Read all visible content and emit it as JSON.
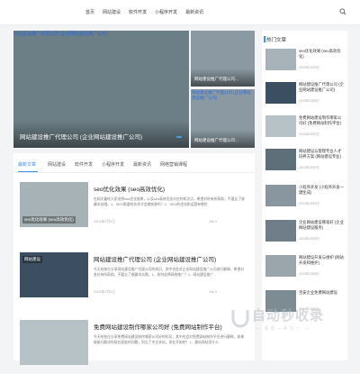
{
  "nav": {
    "items": [
      "首页",
      "网站建设",
      "软件开发",
      "小程序开发",
      "最新资讯"
    ]
  },
  "hero": {
    "image_alt": "网站建设推广代理公司 (企业网站建设推广公司)",
    "caption": "网站建设推广代理公司 (企业网站建设推广公司)"
  },
  "side_cards": [
    {
      "image_alt": "",
      "caption": "网站建设推广代理公司..."
    },
    {
      "image_alt": "网站建设推广代理公司 (企业网站建设推广公司)",
      "caption": "网站建设推广代理公司..."
    }
  ],
  "tabs": [
    "最新文章",
    "网站建设",
    "软件开发",
    "小程序开发",
    "最新资讯",
    "网络营销课程"
  ],
  "articles": [
    {
      "title": "seo优化效果 (seo高效优化)",
      "thumb_label": "seo优化效果 (seo高效优化)",
      "excerpt": "在网文童给大家说到seo优化效果，以及seo高效优化对应的知识点，希望对你有所帮助，不要忘了收藏本站哦。1、SEO需要的技术才会做效果吗？2、SEO的优化和运营有哪些",
      "date": "2024年2月9日",
      "meta": "19k  0"
    },
    {
      "title": "网站建设推广代理公司 (企业网站建设推广公司)",
      "thumb_label": "网站建设",
      "excerpt": "今天给各位分享网站建设推广代理公司的知识，其中也会对企业网站建设推广公司进行解释，希望对各位有所帮助，不要忘了收藏本站哦。1、如何选择网络推广？2、网站建设推广...",
      "date": "2024年2月9日",
      "meta": "19k  0"
    },
    {
      "title": "免费网站建设制作哪家公司好 (免费网站制作平台)",
      "thumb_label": "",
      "excerpt": "今天给各位分享免费网站建设制作哪家公司好的知识，其中也会对免费网站制作平台进行解释，如果能碰巧解决你现在面临的问题，别忘了关注本站，现在开始吧！1、建站网站用什么",
      "date": "",
      "meta": ""
    }
  ],
  "sidebar": {
    "title": "热门文章",
    "items": [
      {
        "text": "seo优化效果 (seo高效优化)",
        "date": "2024年2月9日"
      },
      {
        "text": "网站建设推广代理公司 (企业网站建设推广公司)",
        "date": "2024年2月9日"
      },
      {
        "text": "免费网站建设制作哪家公司好 (免费网站制作平台)",
        "date": "2024年2月9日"
      },
      {
        "text": "网站建设与管理专业人才培养方案 (网站建设专业)",
        "date": "2024年2月9日"
      },
      {
        "text": "小程序开发 (小程序开发一键生成)",
        "date": "2024年2月9日"
      },
      {
        "text": "企业网站建设哪家好 (企业网站建设服务)",
        "date": "2024年2月9日"
      },
      {
        "text": "网站建设开发与维护 (网站开发和维护)",
        "date": "2024年2月9日"
      },
      {
        "text": "宝安企业免费网站建设",
        "date": "2024年2月9日"
      }
    ]
  },
  "watermark": {
    "text": "自动秒收录",
    "sub": "—  收录—来口一  —"
  },
  "colors": {
    "accent": "#3a8ee6"
  }
}
